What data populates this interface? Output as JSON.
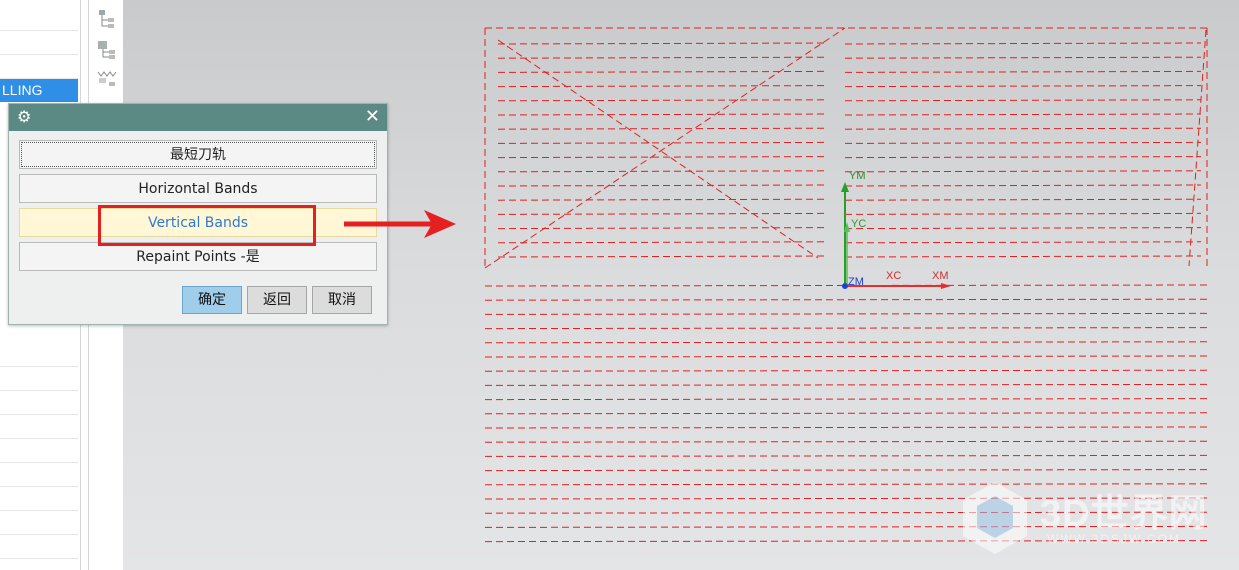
{
  "navigator": {
    "selected_label": "LLING"
  },
  "dialog": {
    "options": [
      "最短刀轨",
      "Horizontal Bands",
      "Vertical Bands",
      "Repaint Points -是"
    ],
    "buttons": {
      "ok": "确定",
      "back": "返回",
      "cancel": "取消"
    }
  },
  "axes": {
    "ym": "YM",
    "yc": "YC",
    "xc": "XC",
    "xm": "XM",
    "zm": "ZM"
  },
  "watermark": {
    "text": "3D世界网",
    "url": "WWW.3DSJW.COM"
  },
  "colors": {
    "toolpath": "#e02020",
    "highlight": "#fff7d6",
    "title_bar": "#5b8a84",
    "selection": "#2f8fe6"
  }
}
